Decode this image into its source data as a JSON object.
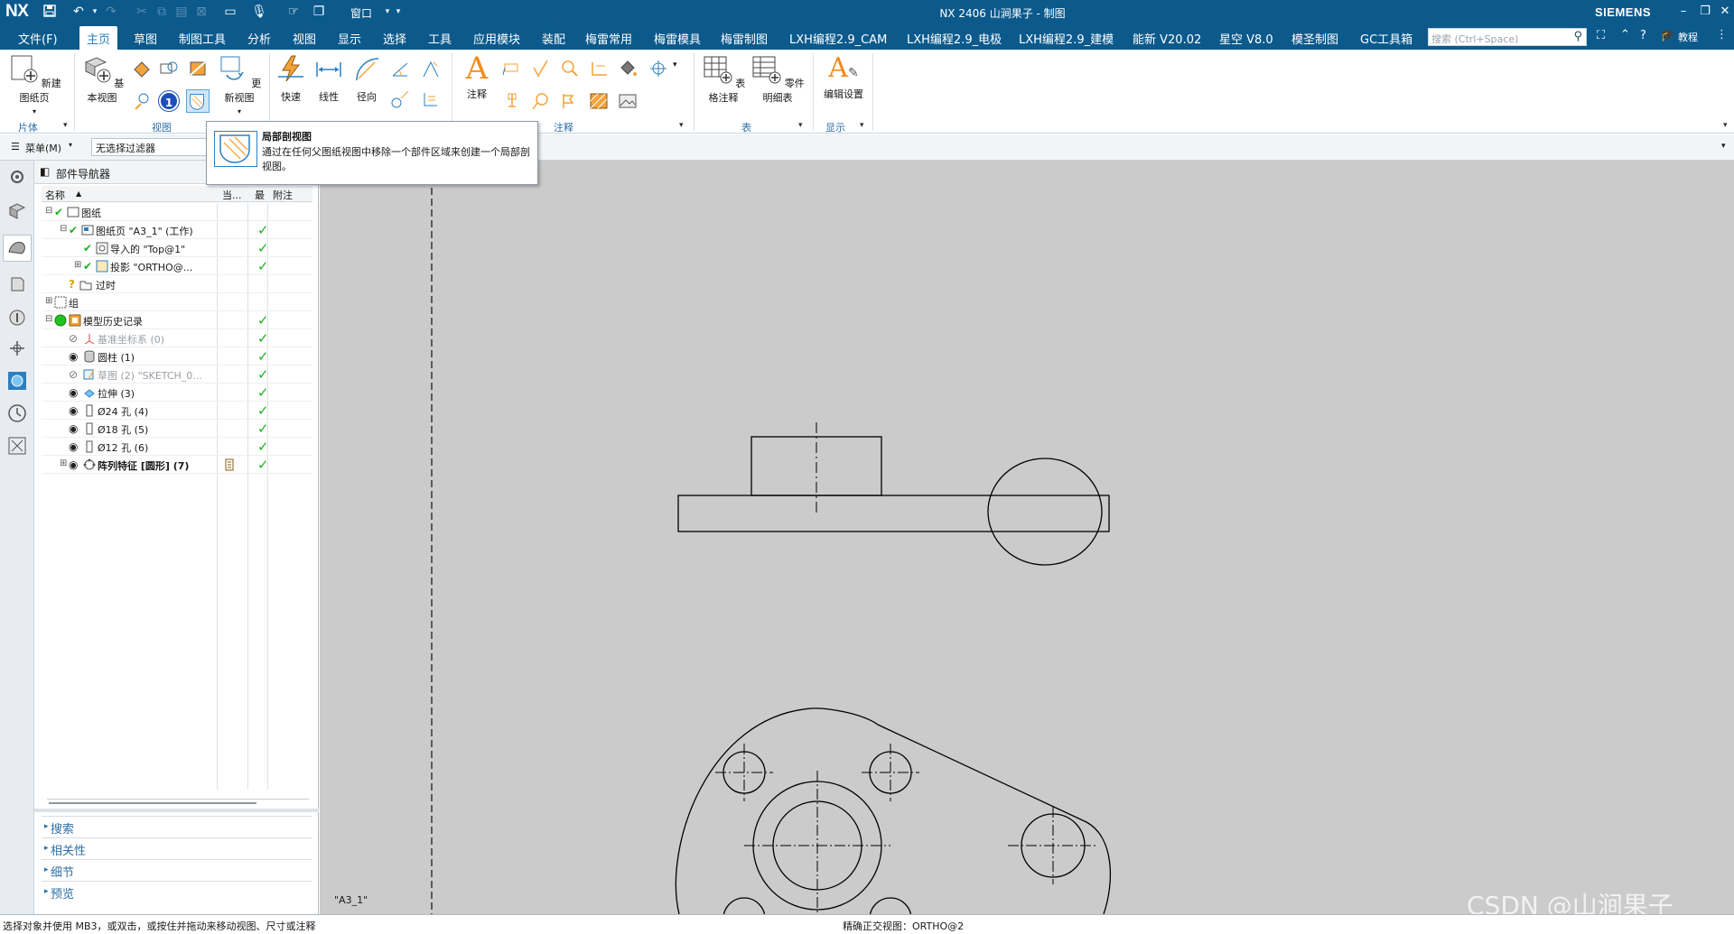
{
  "titlebar": {
    "app_logo": "NX",
    "window_menu": "窗口",
    "title": "NX 2406 山涧果子 - 制图",
    "brand": "SIEMENS",
    "icons": [
      "save-icon",
      "undo-icon",
      "redo-icon",
      "microphone-icon",
      "window-icon",
      "minimize-icon",
      "restore-icon",
      "close-icon"
    ]
  },
  "menubar": {
    "file": "文件(F)",
    "items": [
      "主页",
      "草图",
      "制图工具",
      "分析",
      "视图",
      "显示",
      "选择",
      "工具",
      "应用模块",
      "装配",
      "梅雷常用",
      "梅雷模具",
      "梅雷制图",
      "LXH编程2.9_CAM",
      "LXH编程2.9_电极",
      "LXH编程2.9_建模",
      "能新 V20.02",
      "星空 V8.0",
      "模圣制图",
      "GC工具箱"
    ],
    "active": "主页",
    "search_placeholder": "搜索 (Ctrl+Space)",
    "help_label": "教程"
  },
  "ribbon": {
    "new_sheet": "新建图纸页",
    "base_view": "基本视图",
    "update_view": "更新视图",
    "quick": "快速",
    "linear": "线性",
    "radial": "径向",
    "note": "注释",
    "table_note": "表格注释",
    "parts_list": "零件明细表",
    "edit_settings": "编辑设置",
    "groups": {
      "sheet": "片体",
      "view": "视图",
      "annotation": "注释",
      "table": "表",
      "display": "显示"
    },
    "badge": "1"
  },
  "filterbar": {
    "menu": "菜单(M)",
    "filter": "无选择过滤器"
  },
  "tooltip": {
    "title": "局部剖视图",
    "description": "通过在任何父图纸视图中移除一个部件区域来创建一个局部剖视图。"
  },
  "navigator": {
    "title": "部件导航器",
    "columns": {
      "name": "名称",
      "current": "当...",
      "latest": "最",
      "attachment": "附注"
    },
    "rows": [
      {
        "label": "图纸",
        "check": true
      },
      {
        "label": "图纸页 \"A3_1\" (工作)",
        "check": true
      },
      {
        "label": "导入的 \"Top@1\"",
        "check": true
      },
      {
        "label": "投影 \"ORTHO@...",
        "check": true
      },
      {
        "label": "过时",
        "check": false
      },
      {
        "label": "组",
        "check": false
      },
      {
        "label": "模型历史记录",
        "check": true
      },
      {
        "label": "基准坐标系 (0)",
        "check": true
      },
      {
        "label": "圆柱 (1)",
        "check": true
      },
      {
        "label": "草图 (2) \"SKETCH_0...",
        "check": true
      },
      {
        "label": "拉伸 (3)",
        "check": true
      },
      {
        "label": "Ø24 孔 (4)",
        "check": true
      },
      {
        "label": "Ø18 孔 (5)",
        "check": true
      },
      {
        "label": "Ø12 孔 (6)",
        "check": true
      },
      {
        "label": "阵列特征 [圆形] (7)",
        "check": true
      }
    ],
    "panels": [
      "搜索",
      "相关性",
      "细节",
      "预览"
    ]
  },
  "canvas": {
    "sheet_label": "\"A3_1\"",
    "background": "#cbcbcb"
  },
  "statusbar": {
    "left": "选择对象并使用 MB3，或双击，或按住并拖动来移动视图、尺寸或注释",
    "right": "精确正交视图：ORTHO@2"
  },
  "watermark": "CSDN @山涧果子",
  "colors": {
    "titlebar": "#0c5a8c",
    "accent": "#2d7fbf",
    "check": "#1fb11f"
  }
}
